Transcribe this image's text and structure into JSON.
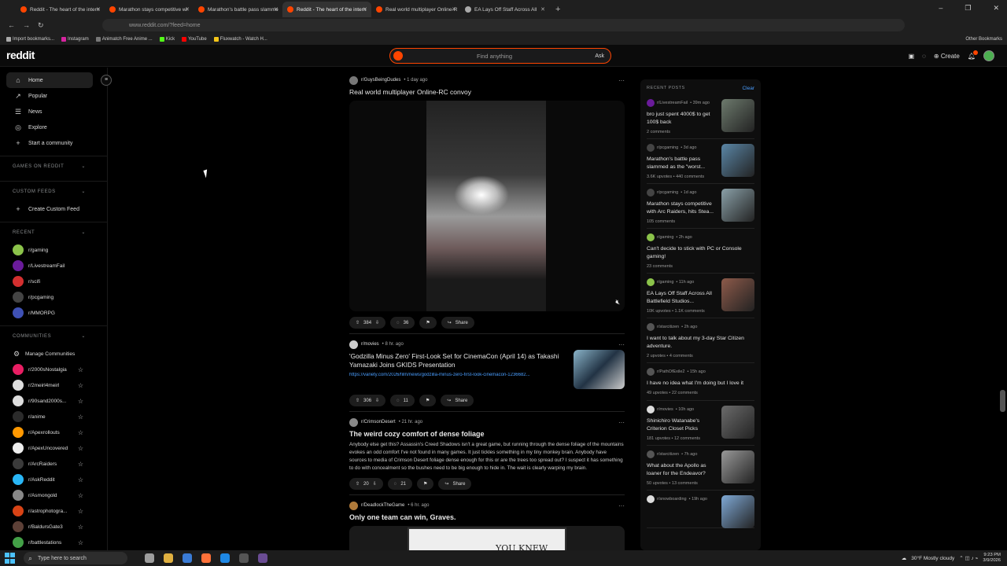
{
  "browser": {
    "tabs": [
      {
        "label": "Reddit - The heart of the intern",
        "active": false,
        "fav": "#ff4500"
      },
      {
        "label": "Marathon stays competitive wi",
        "active": false,
        "fav": "#ff4500"
      },
      {
        "label": "Marathon's battle pass slamme",
        "active": false,
        "fav": "#ff4500"
      },
      {
        "label": "Reddit - The heart of the intern",
        "active": true,
        "fav": "#ff4500"
      },
      {
        "label": "Real world multiplayer Online-R",
        "active": false,
        "fav": "#ff4500"
      },
      {
        "label": "EA Lays Off Staff Across All",
        "active": false,
        "fav": "#aaaaaa"
      }
    ],
    "url": "www.reddit.com/?feed=home",
    "bookmarks": [
      {
        "label": "Import bookmarks...",
        "color": "#aaaaaa"
      },
      {
        "label": "Instagram",
        "color": "#d6249f"
      },
      {
        "label": "Animatch Free Anime ...",
        "color": "#777777"
      },
      {
        "label": "Kick",
        "color": "#53fc18"
      },
      {
        "label": "YouTube",
        "color": "#ff0000"
      },
      {
        "label": "Fluxwatch - Watch H...",
        "color": "#f5c518"
      }
    ],
    "other_bookmarks": "Other Bookmarks"
  },
  "header": {
    "logo": "reddit",
    "search_placeholder": "Find anything",
    "ask": "Ask",
    "create": "Create",
    "notif_count": "1",
    "accent": "#ff4500"
  },
  "sidebar": {
    "main": [
      {
        "label": "Home",
        "icon": "⌂"
      },
      {
        "label": "Popular",
        "icon": "↗"
      },
      {
        "label": "News",
        "icon": "☰"
      },
      {
        "label": "Explore",
        "icon": "◎"
      },
      {
        "label": "Start a community",
        "icon": "+"
      }
    ],
    "games_header": "GAMES ON REDDIT",
    "custom_header": "CUSTOM FEEDS",
    "create_custom": "Create Custom Feed",
    "recent_header": "RECENT",
    "recent": [
      {
        "label": "r/gaming",
        "color": "#8bc34a"
      },
      {
        "label": "r/LivestreamFail",
        "color": "#6a1b9a"
      },
      {
        "label": "r/scifi",
        "color": "#d32f2f"
      },
      {
        "label": "r/pcgaming",
        "color": "#444444"
      },
      {
        "label": "r/MMORPG",
        "color": "#3f51b5"
      }
    ],
    "communities_header": "COMMUNITIES",
    "manage": "Manage Communities",
    "communities": [
      {
        "label": "r/2000sNostalgia",
        "color": "#e91e63"
      },
      {
        "label": "r/2meirl4meirl",
        "color": "#dddddd"
      },
      {
        "label": "r/90sand2000s...",
        "color": "#dddddd"
      },
      {
        "label": "r/anime",
        "color": "#2b2b2b"
      },
      {
        "label": "r/Apexrollouts",
        "color": "#ff9800"
      },
      {
        "label": "r/ApexUncovered",
        "color": "#eeeeee"
      },
      {
        "label": "r/ArcRaiders",
        "color": "#3a3a3a"
      },
      {
        "label": "r/AskReddit",
        "color": "#29b6f6"
      },
      {
        "label": "r/Asmongold",
        "color": "#888888"
      },
      {
        "label": "r/astrophotogra...",
        "color": "#d84315"
      },
      {
        "label": "r/BaldursGate3",
        "color": "#5d4037"
      },
      {
        "label": "r/battlestations",
        "color": "#43a047"
      }
    ]
  },
  "feed": {
    "post1": {
      "sub": "r/GuysBeingDudes",
      "time": "• 1 day ago",
      "title": "Real world multiplayer Online-RC convoy",
      "upvotes": "384",
      "comments": "36",
      "share": "Share"
    },
    "post2": {
      "sub": "r/movies",
      "time": "• 8 hr. ago",
      "title": "'Godzilla Minus Zero' First-Look Set for CinemaCon (April 14) as Takashi Yamazaki Joins GKIDS Presentation",
      "link": "https://variety.com/2026/film/news/godzilla-minus-zero-first-look-cinemacon-1236682...",
      "upvotes": "306",
      "comments": "11",
      "share": "Share"
    },
    "post3": {
      "sub": "r/CrimsonDesert",
      "time": "• 21 hr. ago",
      "title": "The weird cozy comfort of dense foliage",
      "body": "Anybody else get this? Assassin's Creed Shadows isn't a great game, but running through the dense foliage of the mountains evokes an odd comfort I've not found in many games. It just tickles something in my tiny monkey brain. Anybody have sources to media of Crimson Desert foliage dense enough for this or are the trees too spread out? I suspect it has something to do with concealment so the bushes need to be big enough to hide in. The wait is clearly warping my brain.",
      "upvotes": "20",
      "comments": "21",
      "share": "Share"
    },
    "post4": {
      "sub": "r/DeadlockTheGame",
      "time": "• 6 hr. ago",
      "title": "Only one team can win, Graves.",
      "comic_text": "YOU KNEW"
    }
  },
  "recent_posts": {
    "header": "RECENT POSTS",
    "clear": "Clear",
    "items": [
      {
        "sub": "r/LivestreamFail",
        "time": "• 39m ago",
        "title": "bro just spent 4000$ to get 100$ back",
        "stats": "2 comments",
        "thumb": "#6d7a6d",
        "av": "#6a1b9a"
      },
      {
        "sub": "r/pcgaming",
        "time": "• 3d ago",
        "title": "Marathon's battle pass slammed as the \"worst...",
        "stats": "3.6K upvotes • 440 comments",
        "thumb": "#5a86a6",
        "av": "#444444"
      },
      {
        "sub": "r/pcgaming",
        "time": "• 1d ago",
        "title": "Marathon stays competitive with Arc Raiders, hits Stea...",
        "stats": "105 comments",
        "thumb": "#8aa0a8",
        "av": "#444444"
      },
      {
        "sub": "r/gaming",
        "time": "• 2h ago",
        "title": "Can't decide to stick with PC or Console gaming!",
        "stats": "23 comments",
        "thumb": "",
        "av": "#8bc34a"
      },
      {
        "sub": "r/gaming",
        "time": "• 11h ago",
        "title": "EA Lays Off Staff Across All Battlefield Studios...",
        "stats": "10K upvotes • 1.1K comments",
        "thumb": "#8d5a4a",
        "av": "#8bc34a"
      },
      {
        "sub": "r/starcitizen",
        "time": "• 2h ago",
        "title": "I want to talk about my 3-day Star Citizen adventure.",
        "stats": "2 upvotes • 4 comments",
        "thumb": "",
        "av": "#555555"
      },
      {
        "sub": "r/PathOfExile2",
        "time": "• 15h ago",
        "title": "I have no idea what I'm doing but I love it",
        "stats": "49 upvotes • 22 comments",
        "thumb": "",
        "av": "#555555"
      },
      {
        "sub": "r/movies",
        "time": "• 10h ago",
        "title": "Shinichiro Watanabe's Criterion Closet Picks",
        "stats": "181 upvotes • 12 comments",
        "thumb": "#6b6b6b",
        "av": "#dddddd"
      },
      {
        "sub": "r/starcitizen",
        "time": "• 7h ago",
        "title": "What about the Apollo as loaner for the Endeavor?",
        "stats": "50 upvotes • 13 comments",
        "thumb": "#999999",
        "av": "#555555"
      },
      {
        "sub": "r/snowboarding",
        "time": "• 19h ago",
        "title": "",
        "stats": "",
        "thumb": "#7fa9d6",
        "av": "#dddddd"
      }
    ]
  },
  "taskbar": {
    "search": "Type here to search",
    "weather": "30°F  Mostly cloudy",
    "time": "9:23 PM",
    "date": "3/9/2026",
    "apps": [
      "#9e9e9e",
      "#e0b040",
      "#3a7bd5",
      "#ff7139",
      "#1e88e5",
      "#555555",
      "#6a4c93"
    ]
  }
}
